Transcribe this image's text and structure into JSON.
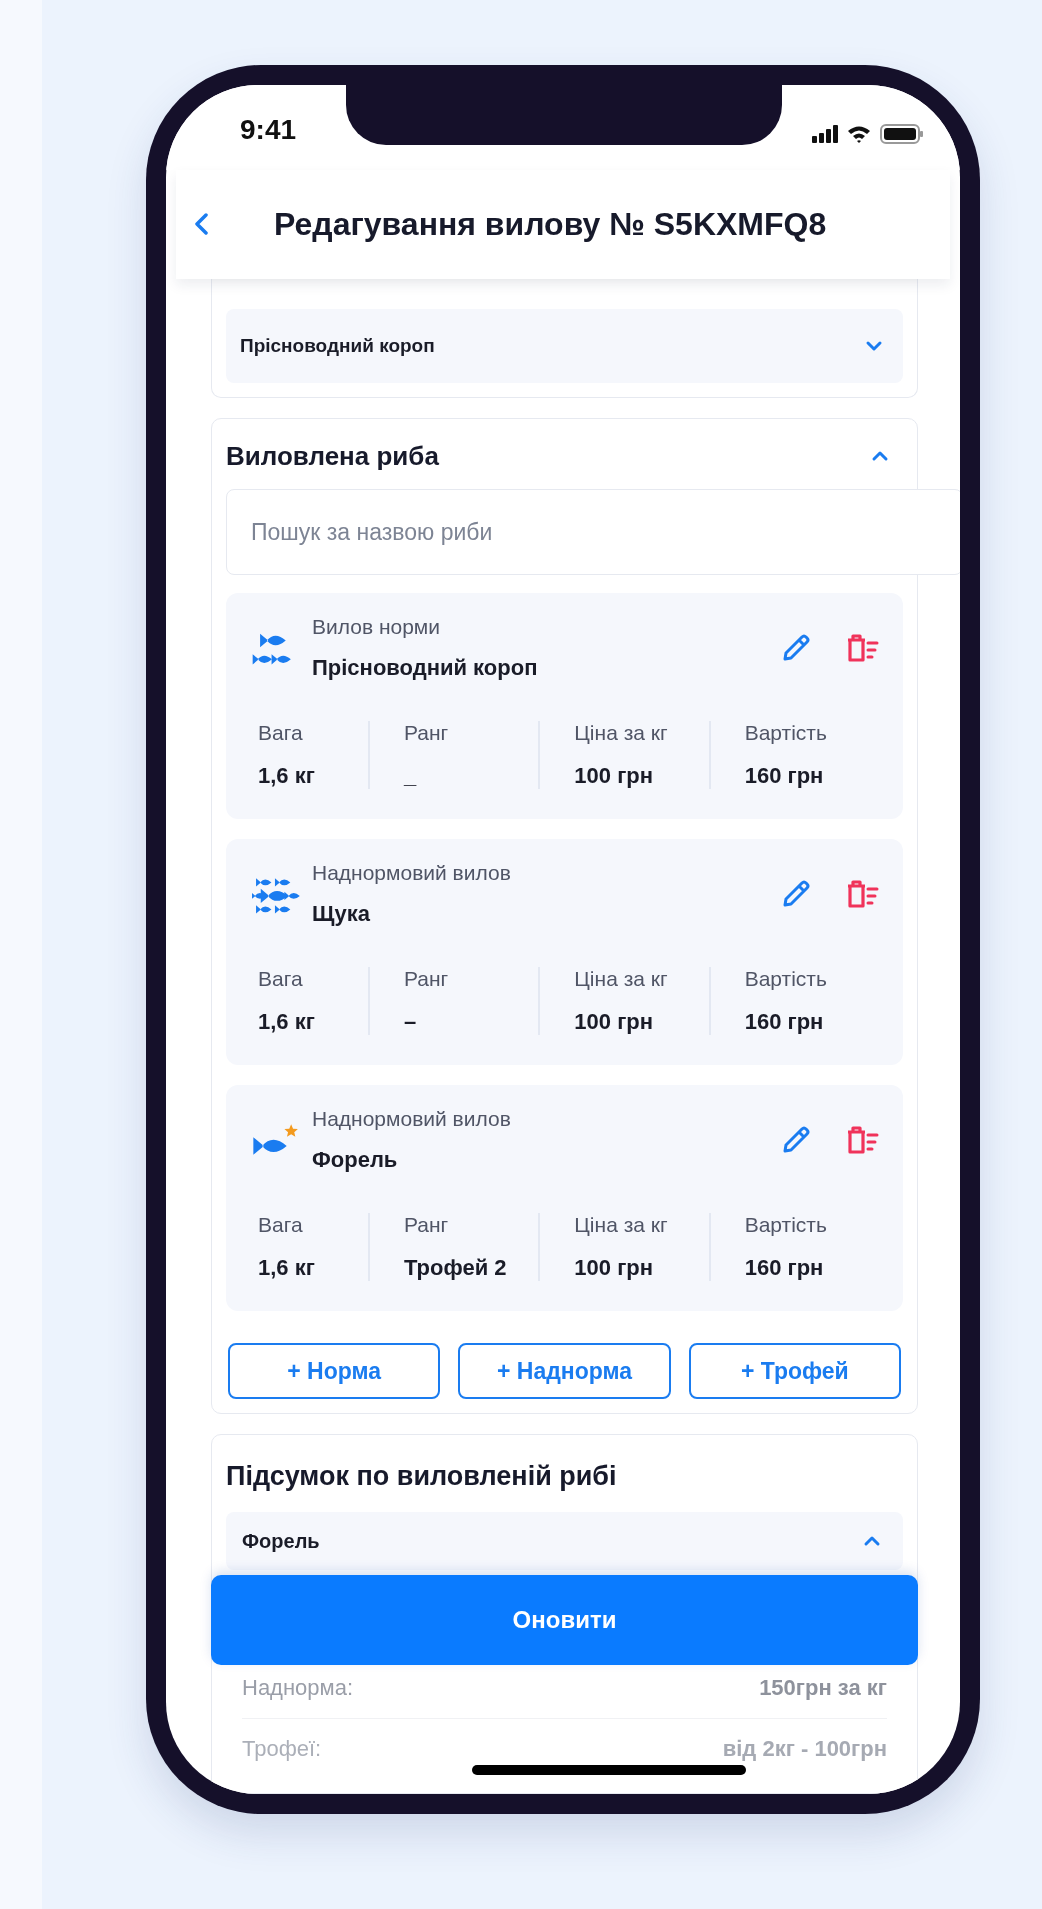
{
  "status_bar": {
    "time": "9:41"
  },
  "header": {
    "title": "Редагування вилову № S5KXMFQ8"
  },
  "fish_type_select": {
    "value": "Прісноводний короп",
    "expanded": false
  },
  "caught_fish": {
    "title": "Виловлена риба",
    "expanded": true,
    "search": {
      "placeholder": "Пошук за назвою риби"
    },
    "items": [
      {
        "kind": "norm",
        "category": "Вилов норми",
        "name": "Прісноводний короп",
        "fields": [
          {
            "label": "Вага",
            "value": "1,6 кг"
          },
          {
            "label": "Ранг",
            "value": "_"
          },
          {
            "label": "Ціна за кг",
            "value": "100 грн"
          },
          {
            "label": "Вартість",
            "value": "160 грн"
          }
        ]
      },
      {
        "kind": "over",
        "category": "Наднормовий вилов",
        "name": "Щука",
        "fields": [
          {
            "label": "Вага",
            "value": "1,6 кг"
          },
          {
            "label": "Ранг",
            "value": "–"
          },
          {
            "label": "Ціна за кг",
            "value": "100 грн"
          },
          {
            "label": "Вартість",
            "value": "160 грн"
          }
        ]
      },
      {
        "kind": "trophy",
        "category": "Наднормовий вилов",
        "name": "Форель",
        "fields": [
          {
            "label": "Вага",
            "value": "1,6 кг"
          },
          {
            "label": "Ранг",
            "value": "Трофей 2"
          },
          {
            "label": "Ціна за кг",
            "value": "100 грн"
          },
          {
            "label": "Вартість",
            "value": "160 грн"
          }
        ]
      }
    ],
    "add_buttons": [
      "+ Норма",
      "+ Наднорма",
      "+ Трофей"
    ]
  },
  "summary": {
    "title": "Підсумок по виловленій рибі",
    "fish": {
      "name": "Форель",
      "expanded": true
    },
    "rows": [
      {
        "label": "Наднорма:",
        "value": "150грн за кг"
      },
      {
        "label": "Трофеї:",
        "value": "від 2кг - 100грн"
      }
    ]
  },
  "update_button": "Оновити"
}
